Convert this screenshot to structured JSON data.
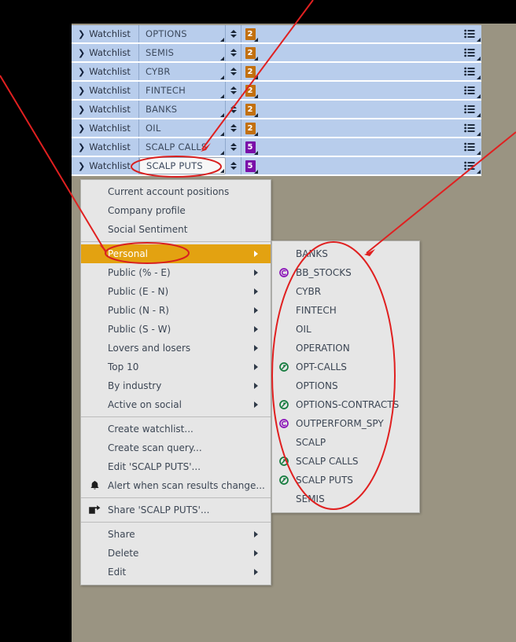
{
  "watchlist_rows": [
    {
      "type_label": "Watchlist",
      "name": "OPTIONS",
      "count": "2",
      "count_color": "orange",
      "focused": false
    },
    {
      "type_label": "Watchlist",
      "name": "SEMIS",
      "count": "2",
      "count_color": "orange",
      "focused": false
    },
    {
      "type_label": "Watchlist",
      "name": "CYBR",
      "count": "2",
      "count_color": "orange",
      "focused": false
    },
    {
      "type_label": "Watchlist",
      "name": "FINTECH",
      "count": "2",
      "count_color": "orange",
      "focused": false
    },
    {
      "type_label": "Watchlist",
      "name": "BANKS",
      "count": "2",
      "count_color": "orange",
      "focused": false
    },
    {
      "type_label": "Watchlist",
      "name": "OIL",
      "count": "2",
      "count_color": "orange",
      "focused": false
    },
    {
      "type_label": "Watchlist",
      "name": "SCALP CALLS",
      "count": "5",
      "count_color": "purple",
      "focused": false
    },
    {
      "type_label": "Watchlist",
      "name": "SCALP PUTS",
      "count": "5",
      "count_color": "purple",
      "focused": true
    }
  ],
  "context_menu": {
    "items": [
      {
        "label": "Current account positions",
        "submenu": false,
        "icon": null,
        "highlighted": false,
        "sep_after": false
      },
      {
        "label": "Company profile",
        "submenu": false,
        "icon": null,
        "highlighted": false,
        "sep_after": false
      },
      {
        "label": "Social Sentiment",
        "submenu": false,
        "icon": null,
        "highlighted": false,
        "sep_after": true
      },
      {
        "label": "Personal",
        "submenu": true,
        "icon": null,
        "highlighted": true,
        "sep_after": false
      },
      {
        "label": "Public (% - E)",
        "submenu": true,
        "icon": null,
        "highlighted": false,
        "sep_after": false
      },
      {
        "label": "Public (E - N)",
        "submenu": true,
        "icon": null,
        "highlighted": false,
        "sep_after": false
      },
      {
        "label": "Public (N - R)",
        "submenu": true,
        "icon": null,
        "highlighted": false,
        "sep_after": false
      },
      {
        "label": "Public (S - W)",
        "submenu": true,
        "icon": null,
        "highlighted": false,
        "sep_after": false
      },
      {
        "label": "Lovers and losers",
        "submenu": true,
        "icon": null,
        "highlighted": false,
        "sep_after": false
      },
      {
        "label": "Top 10",
        "submenu": true,
        "icon": null,
        "highlighted": false,
        "sep_after": false
      },
      {
        "label": "By industry",
        "submenu": true,
        "icon": null,
        "highlighted": false,
        "sep_after": false
      },
      {
        "label": "Active on social",
        "submenu": true,
        "icon": null,
        "highlighted": false,
        "sep_after": true
      },
      {
        "label": "Create watchlist...",
        "submenu": false,
        "icon": null,
        "highlighted": false,
        "sep_after": false
      },
      {
        "label": "Create scan query...",
        "submenu": false,
        "icon": null,
        "highlighted": false,
        "sep_after": false
      },
      {
        "label": "Edit 'SCALP PUTS'...",
        "submenu": false,
        "icon": null,
        "highlighted": false,
        "sep_after": false
      },
      {
        "label": "Alert when scan results change...",
        "submenu": false,
        "icon": "bell-icon",
        "highlighted": false,
        "sep_after": true
      },
      {
        "label": "Share 'SCALP PUTS'...",
        "submenu": false,
        "icon": "share-icon",
        "highlighted": false,
        "sep_after": true
      },
      {
        "label": "Share",
        "submenu": true,
        "icon": null,
        "highlighted": false,
        "sep_after": false
      },
      {
        "label": "Delete",
        "submenu": true,
        "icon": null,
        "highlighted": false,
        "sep_after": false
      },
      {
        "label": "Edit",
        "submenu": true,
        "icon": null,
        "highlighted": false,
        "sep_after": false
      }
    ]
  },
  "submenu": {
    "parent": "Personal",
    "items": [
      {
        "label": "BANKS",
        "icon": null
      },
      {
        "label": "BB_STOCKS",
        "icon": "purple-scan-icon"
      },
      {
        "label": "CYBR",
        "icon": null
      },
      {
        "label": "FINTECH",
        "icon": null
      },
      {
        "label": "OIL",
        "icon": null
      },
      {
        "label": "OPERATION",
        "icon": null
      },
      {
        "label": "OPT-CALLS",
        "icon": "green-scan-icon"
      },
      {
        "label": "OPTIONS",
        "icon": null
      },
      {
        "label": "OPTIONS-CONTRACTS",
        "icon": "green-scan-icon"
      },
      {
        "label": "OUTPERFORM_SPY",
        "icon": "purple-scan-icon"
      },
      {
        "label": "SCALP",
        "icon": null
      },
      {
        "label": "SCALP CALLS",
        "icon": "green-scan-icon"
      },
      {
        "label": "SCALP PUTS",
        "icon": "green-scan-icon"
      },
      {
        "label": "SEMIS",
        "icon": null
      }
    ]
  },
  "colors": {
    "backdrop": "#9a9482",
    "row_blue": "#b8cdec",
    "menu_bg": "#e6e6e6",
    "highlight_orange": "#e3a211",
    "badge_orange": "#c2700f",
    "badge_purple": "#7a0fa8",
    "annotation_red": "#e02020",
    "green_icon": "#137a3c",
    "purple_icon": "#8a12b8"
  },
  "annotations": {
    "ellipses": [
      {
        "name": "scalp-puts-field-ellipse"
      },
      {
        "name": "personal-item-ellipse"
      },
      {
        "name": "submenu-list-ellipse"
      }
    ],
    "arrows": [
      {
        "name": "arrow-to-scalp-calls"
      },
      {
        "name": "arrow-to-personal"
      },
      {
        "name": "arrow-to-submenu"
      }
    ]
  }
}
